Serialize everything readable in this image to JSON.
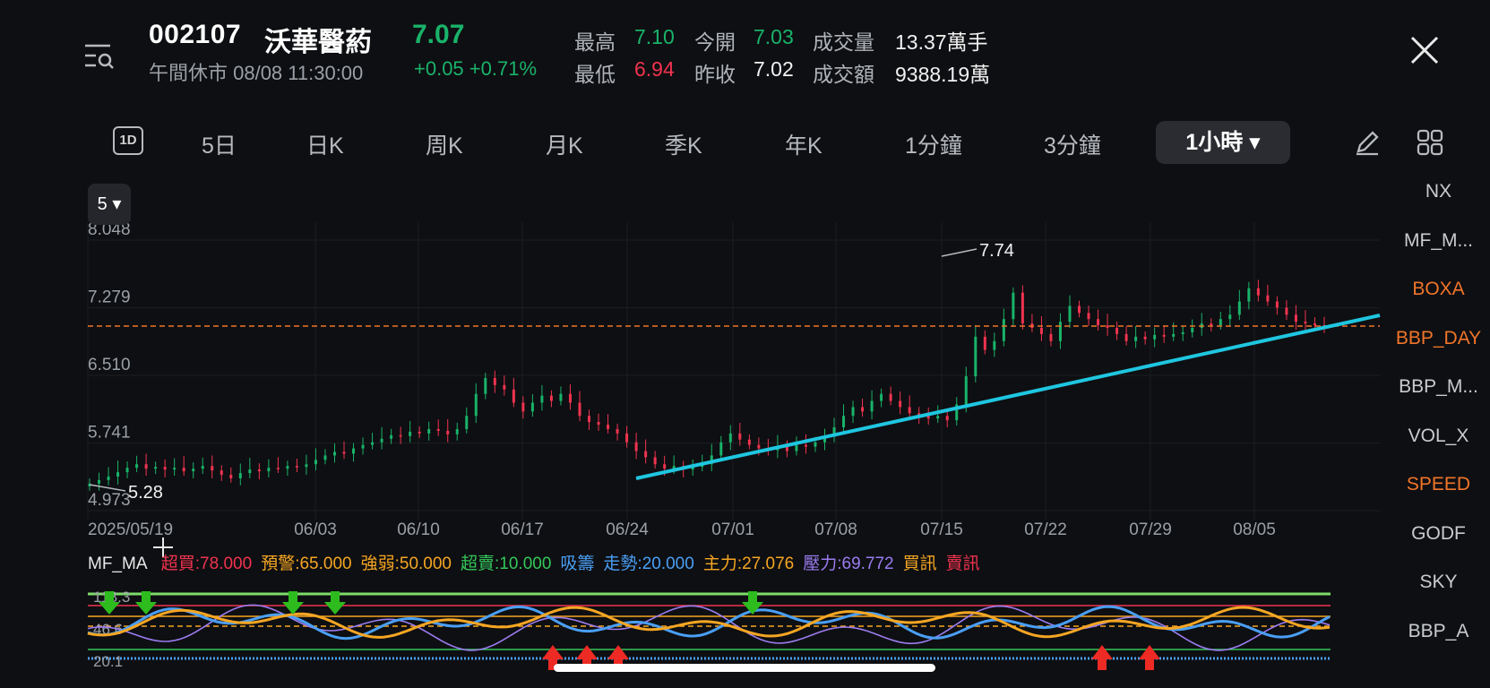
{
  "header": {
    "code": "002107",
    "name": "沃華醫葯",
    "price": "7.07",
    "status": "午間休市 08/08 11:30:00",
    "change": "+0.05",
    "change_pct": "+0.71%",
    "stats": {
      "high_label": "最高",
      "high": "7.10",
      "open_label": "今開",
      "open": "7.03",
      "volume_label": "成交量",
      "volume": "13.37萬手",
      "low_label": "最低",
      "low": "6.94",
      "prev_label": "昨收",
      "prev": "7.02",
      "amount_label": "成交額",
      "amount": "9388.19萬"
    }
  },
  "tabs": {
    "t1d": "1D",
    "t5d": "5日",
    "day": "日K",
    "week": "周K",
    "month": "月K",
    "quarter": "季K",
    "year": "年K",
    "m1": "1分鐘",
    "m3": "3分鐘",
    "active": "1小時 ▾"
  },
  "period_selector": "5 ▾",
  "side_indicators": [
    "NX",
    "MF_M...",
    "BOXA",
    "BBP_DAY",
    "BBP_M...",
    "VOL_X",
    "SPEED",
    "GODF",
    "SKY",
    "BBP_A"
  ],
  "side_active": [
    "BOXA",
    "BBP_DAY",
    "SPEED"
  ],
  "colors": {
    "up": "#f0334f",
    "down": "#19b36a",
    "trend": "#1fc6e0",
    "ref_line": "#f0752a"
  },
  "main_indicator": {
    "name": "MF_MA",
    "items": [
      {
        "text": "超買:78.000",
        "color": "#f0334f"
      },
      {
        "text": "預警:65.000",
        "color": "#f5a623"
      },
      {
        "text": "強弱:50.000",
        "color": "#f5a623"
      },
      {
        "text": "超賣:10.000",
        "color": "#34c759"
      },
      {
        "text": "吸籌",
        "color": "#4a9ff5"
      },
      {
        "text": "走勢:20.000",
        "color": "#4a9ff5"
      },
      {
        "text": "主力:27.076",
        "color": "#f5a623"
      },
      {
        "text": "壓力:69.772",
        "color": "#9b7cf0"
      },
      {
        "text": "買訊",
        "color": "#f5a623"
      },
      {
        "text": "賣訊",
        "color": "#f0334f"
      }
    ]
  },
  "chart_data": {
    "type": "candlestick",
    "y_ticks": [
      "8.048",
      "7.279",
      "6.510",
      "5.741",
      "4.973"
    ],
    "ylim": [
      4.973,
      8.048
    ],
    "x_ticks": [
      "2025/05/19",
      "06/03",
      "06/10",
      "06/17",
      "06/24",
      "07/01",
      "07/08",
      "07/15",
      "07/22",
      "07/29",
      "08/05"
    ],
    "annotations": [
      {
        "text": "7.74",
        "value": 7.74
      },
      {
        "text": "5.28",
        "value": 5.28
      }
    ],
    "reference_price": 7.07,
    "closes": [
      5.28,
      5.32,
      5.36,
      5.41,
      5.46,
      5.5,
      5.45,
      5.47,
      5.44,
      5.46,
      5.42,
      5.45,
      5.48,
      5.43,
      5.38,
      5.34,
      5.4,
      5.44,
      5.42,
      5.46,
      5.45,
      5.48,
      5.47,
      5.5,
      5.55,
      5.6,
      5.64,
      5.62,
      5.68,
      5.72,
      5.75,
      5.79,
      5.83,
      5.82,
      5.87,
      5.85,
      5.9,
      5.88,
      5.84,
      5.9,
      6.05,
      6.3,
      6.48,
      6.4,
      6.35,
      6.2,
      6.1,
      6.2,
      6.28,
      6.22,
      6.3,
      6.2,
      6.05,
      5.98,
      5.95,
      5.9,
      5.85,
      5.75,
      5.65,
      5.58,
      5.5,
      5.45,
      5.48,
      5.44,
      5.47,
      5.5,
      5.6,
      5.75,
      5.85,
      5.78,
      5.72,
      5.68,
      5.66,
      5.7,
      5.65,
      5.72,
      5.7,
      5.75,
      5.82,
      5.92,
      6.05,
      6.15,
      6.1,
      6.22,
      6.3,
      6.22,
      6.15,
      6.08,
      6.05,
      6.02,
      6.05,
      6.0,
      6.18,
      6.5,
      6.95,
      6.8,
      6.9,
      7.15,
      7.45,
      7.1,
      7.05,
      6.98,
      6.9,
      7.12,
      7.3,
      7.22,
      7.15,
      7.08,
      7.05,
      6.98,
      6.9,
      6.95,
      6.92,
      6.97,
      6.95,
      6.98,
      7.0,
      7.05,
      7.1,
      7.08,
      7.15,
      7.2,
      7.35,
      7.5,
      7.42,
      7.35,
      7.28,
      7.2,
      7.12,
      7.1,
      7.08,
      7.07
    ],
    "indicator_ticks": [
      "113.3",
      "46.6",
      "20.1"
    ]
  }
}
